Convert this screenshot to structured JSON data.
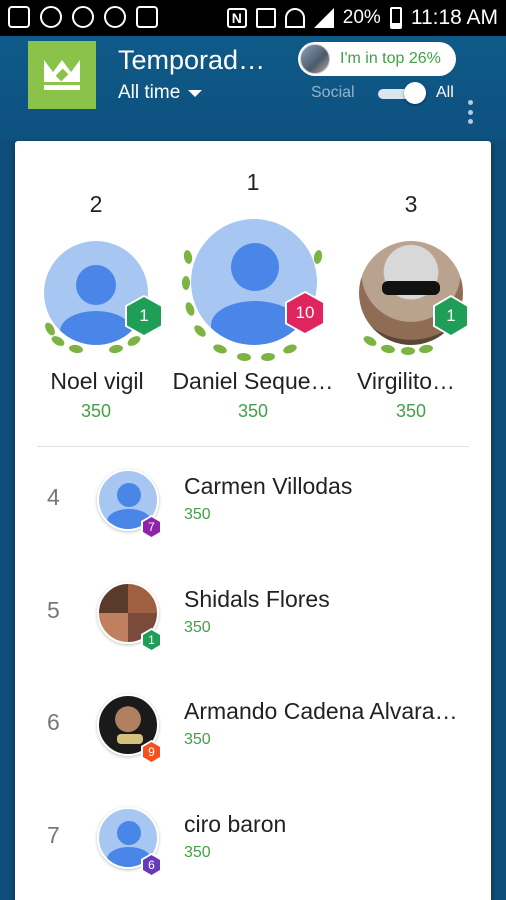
{
  "status_bar": {
    "battery": "20%",
    "time": "11:18 AM"
  },
  "header": {
    "title": "Temporad…",
    "filter_label": "All time",
    "rank_pill": "I'm in top 26%",
    "toggle_left": "Social",
    "toggle_right": "All",
    "toggle_on": true
  },
  "podium": [
    {
      "rank": "2",
      "name": "Noel vigil",
      "score": "350",
      "badge": "1",
      "badge_color": "#1e9e57"
    },
    {
      "rank": "1",
      "name": "Daniel Seque…",
      "score": "350",
      "badge": "10",
      "badge_color": "#e0245e"
    },
    {
      "rank": "3",
      "name": "Virgilito…",
      "score": "350",
      "badge": "1",
      "badge_color": "#1e9e57"
    }
  ],
  "rows": [
    {
      "rank": "4",
      "name": "Carmen Villodas",
      "score": "350",
      "badge": "7",
      "badge_color": "#8e24aa"
    },
    {
      "rank": "5",
      "name": "Shidals Flores",
      "score": "350",
      "badge": "1",
      "badge_color": "#1e9e57"
    },
    {
      "rank": "6",
      "name": "Armando Cadena Alvara…",
      "score": "350",
      "badge": "9",
      "badge_color": "#f4511e"
    },
    {
      "rank": "7",
      "name": "ciro baron",
      "score": "350",
      "badge": "6",
      "badge_color": "#673ab7"
    }
  ]
}
